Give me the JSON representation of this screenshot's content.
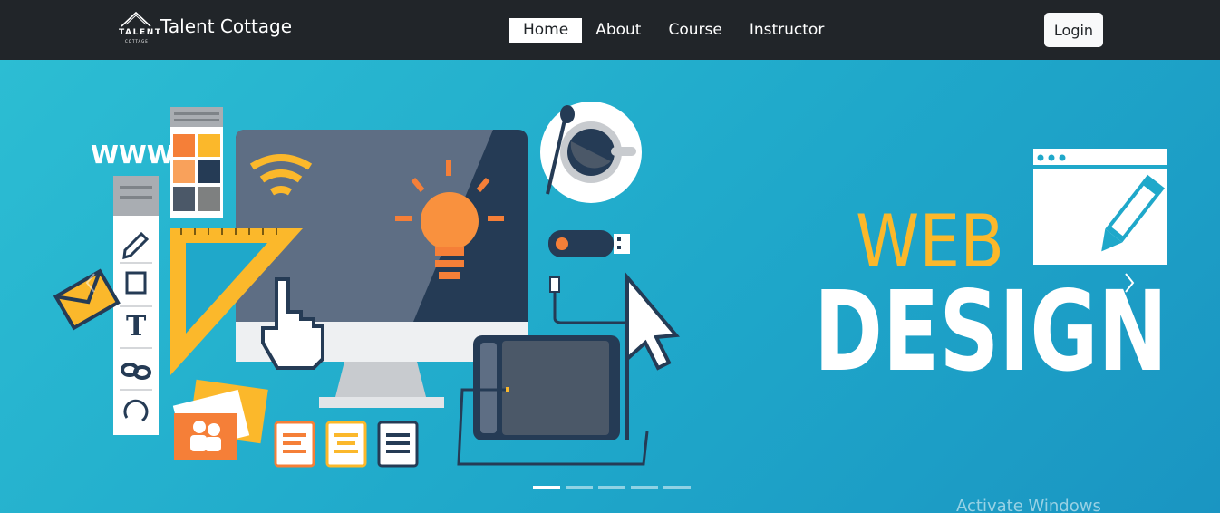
{
  "brand": {
    "logo_line1": "TALENT",
    "logo_line2": "COTTAGE",
    "name": "Talent Cottage"
  },
  "nav": {
    "items": [
      {
        "label": "Home",
        "active": true
      },
      {
        "label": "About",
        "active": false
      },
      {
        "label": "Course",
        "active": false
      },
      {
        "label": "Instructor",
        "active": false
      }
    ]
  },
  "login_label": "Login",
  "hero": {
    "www_text": "WWW",
    "headline_1": "WEB",
    "headline_2": "DESIGN",
    "slides_total": 5,
    "active_slide": 1
  },
  "colors": {
    "navbar": "#212529",
    "hero_bg": "#1fa8ca",
    "accent_yellow": "#fbb82b",
    "accent_orange": "#f57f38",
    "dark_navy": "#253b55"
  },
  "watermark": "Activate Windows"
}
